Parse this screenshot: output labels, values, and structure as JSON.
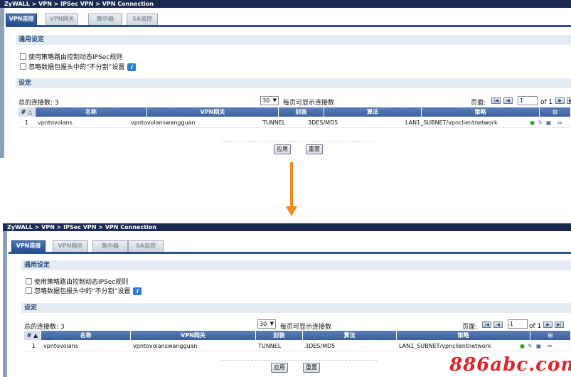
{
  "top": {
    "breadcrumb": "ZyWALL > VPN > IPSec VPN > VPN Connection",
    "tabs": [
      "VPN连接",
      "VPN网关",
      "集中器",
      "SA监控"
    ],
    "general_section": "通用设定",
    "opt1": "使用策略路由控制动态IPSec规则",
    "opt2": "忽略数据包报头中的“不分割”设置",
    "settings_section": "设定",
    "total_label": "总的连接数: 3",
    "per_page_value": "30",
    "per_page_label": "每页可显示连接数",
    "page_label": "页面:",
    "page_value": "1",
    "page_of": "of 1",
    "columns": [
      "#",
      "名称",
      "VPN网关",
      "封装",
      "算法",
      "策略"
    ],
    "row": {
      "index": "1",
      "name": "vpntovolans",
      "gateway": "vpntovolanswangguan",
      "encap": "TUNNEL",
      "algorithm": "3DES/MD5",
      "policy": "LAN1_SUBNET/vpnclientnetwork"
    },
    "apply": "应用",
    "reset": "重置"
  },
  "bottom": {
    "breadcrumb": "ZyWALL > VPN > IPSec VPN > VPN Connection",
    "tabs": [
      "VPN连接",
      "VPN网关",
      "集中器",
      "SA监控"
    ],
    "general_section": "通用设定",
    "opt1": "使用策略路由控制动态IPSec规则",
    "opt2": "忽略数据包报头中的“不分割”设置",
    "settings_section": "设定",
    "total_label": "总的连接数: 3",
    "per_page_value": "30",
    "per_page_label": "每页可显示连接数",
    "page_label": "页面:",
    "page_value": "1",
    "page_of": "of 1",
    "columns": [
      "#",
      "名称",
      "VPN网关",
      "封装",
      "算法",
      "策略"
    ],
    "row": {
      "index": "1",
      "name": "vpntovolans",
      "gateway": "vpntovolanswangguan",
      "encap": "TUNNEL",
      "algorithm": "3DES/MD5",
      "policy": "LAN1_SUBNET/vpnclientnetwork"
    },
    "apply": "应用",
    "reset": "重置"
  },
  "icons": {
    "info": "info-icon",
    "sort": "sort-triangle-icon",
    "add": "add-icon",
    "status": "bulb-icon",
    "edit": "edit-icon",
    "delete": "trash-icon",
    "connect": "connect-icon",
    "arrow": "arrow-down-icon"
  },
  "colors": {
    "title_bar": "#1a2a52",
    "tab_active": "#2b5190",
    "arrow": "#f08a1c",
    "watermark": "#e0242b"
  },
  "watermark": "886abc.com"
}
